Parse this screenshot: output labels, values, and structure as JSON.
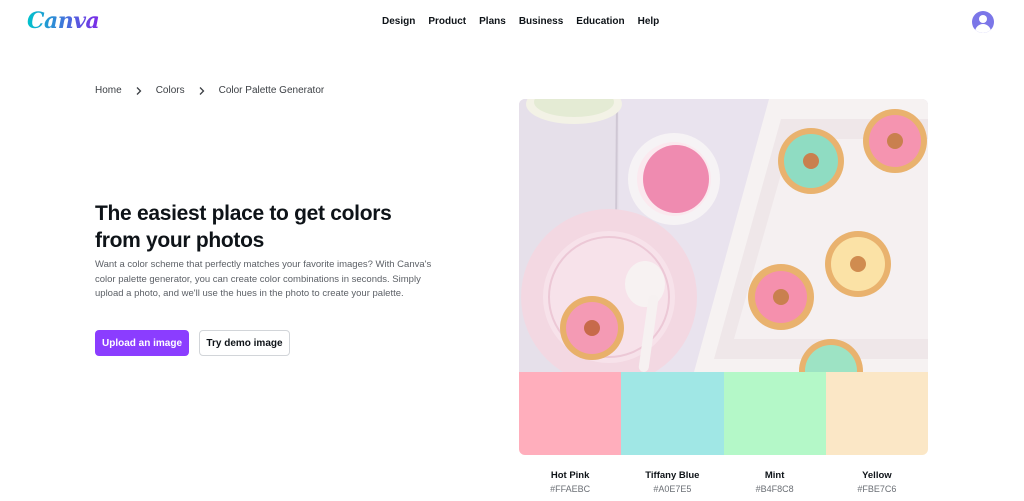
{
  "header": {
    "logo": "Canva",
    "nav": [
      "Design",
      "Product",
      "Plans",
      "Business",
      "Education",
      "Help"
    ]
  },
  "breadcrumb": {
    "home": "Home",
    "colors": "Colors",
    "current": "Color Palette Generator"
  },
  "hero": {
    "title": "The easiest place to get colors from your photos",
    "description": "Want a color scheme that perfectly matches your favorite images? With Canva's color palette generator, you can create color combinations in seconds. Simply upload a photo, and we'll use the hues in the photo to create your palette.",
    "upload_label": "Upload an image",
    "demo_label": "Try demo image"
  },
  "palette": [
    {
      "name": "Hot Pink",
      "hex": "#FFAEBC",
      "color": "#ffaebc"
    },
    {
      "name": "Tiffany Blue",
      "hex": "#A0E7E5",
      "color": "#a0e7e5"
    },
    {
      "name": "Mint",
      "hex": "#B4F8C8",
      "color": "#b4f8c8"
    },
    {
      "name": "Yellow",
      "hex": "#FBE7C6",
      "color": "#fbe7c6"
    }
  ],
  "icons": {
    "avatar": "user-avatar-icon",
    "breadcrumb_separator": "chevron-right-icon"
  }
}
